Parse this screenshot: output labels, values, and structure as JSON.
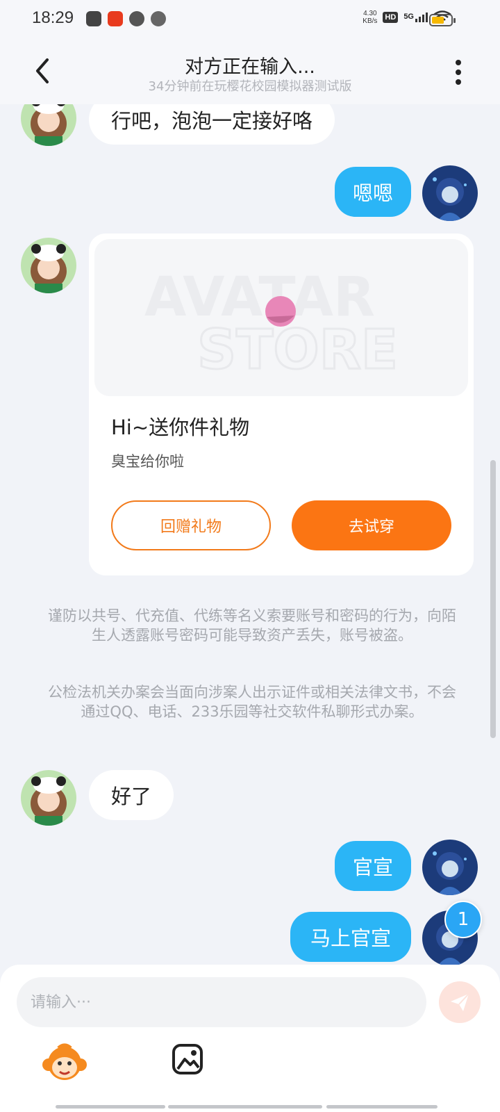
{
  "status_bar": {
    "time": "18:29",
    "net_speed_value": "4.30",
    "net_speed_unit": "KB/s",
    "hd": "HD",
    "signal": "5G",
    "battery_percent": 65,
    "battery_color": "#f6b800"
  },
  "header": {
    "title": "对方正在输入...",
    "subtitle": "34分钟前在玩樱花校园模拟器测试版"
  },
  "messages": {
    "m1": "行吧，泡泡一定接好咯",
    "m2": "嗯嗯",
    "m3": "好了",
    "m4": "官宣",
    "m5": "马上官宣"
  },
  "gift_card": {
    "watermark_line1": "AVATAR",
    "watermark_line2": "STORE",
    "title": "Hi~送你件礼物",
    "description": "臭宝给你啦",
    "return_gift_label": "回赠礼物",
    "try_on_label": "去试穿"
  },
  "notices": {
    "n1": "谨防以共号、代充值、代练等名义索要账号和密码的行为，向陌生人透露账号密码可能导致资产丢失，账号被盗。",
    "n2": "公检法机关办案会当面向涉案人出示证件或相关法律文书，不会通过QQ、电话、233乐园等社交软件私聊形式办案。"
  },
  "new_message_badge": "1",
  "input": {
    "placeholder": "请输入···"
  },
  "colors": {
    "accent_blue": "#2bb5f6",
    "accent_orange": "#fb7513",
    "background": "#f1f3f8"
  },
  "icons": {
    "back": "chevron-left-icon",
    "more": "more-vertical-icon",
    "send": "send-icon",
    "emoji": "monkey-emoji-icon",
    "image": "image-icon"
  }
}
